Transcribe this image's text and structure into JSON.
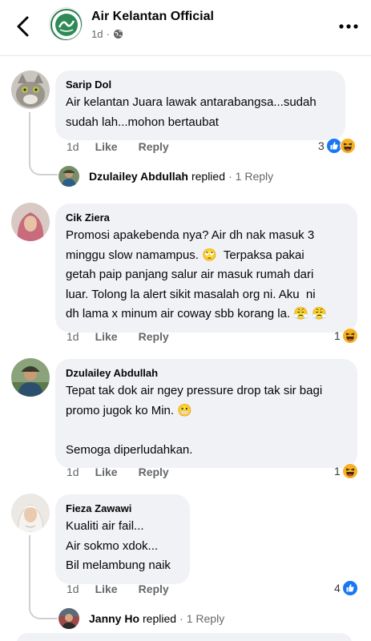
{
  "header": {
    "title": "Air Kelantan Official",
    "time": "1d",
    "privacy_icon": "globe-icon",
    "back_icon": "chevron-left-icon",
    "more_icon": "more-horizontal-icon"
  },
  "comments": [
    {
      "author": "Sarip Dol",
      "text": "Air kelantan Juara lawak antarabangsa...sudah\nsudah lah...mohon bertaubat",
      "time": "1d",
      "like": "Like",
      "reply": "Reply",
      "reactions": {
        "count": "3",
        "icons": [
          "like-reaction-icon",
          "haha-reaction-icon"
        ]
      },
      "replies": {
        "name": "Dzulailey Abdullah",
        "word": "replied",
        "dot": "·",
        "count": "1 Reply"
      }
    },
    {
      "author": "Cik Ziera",
      "text": "Promosi apakebenda nya? Air dh nak masuk 3\nminggu slow namampus. 🙄  Terpaksa pakai\ngetah paip panjang salur air masuk rumah dari\nluar. Tolong la alert sikit masalah org ni. Aku  ni\ndh lama x minum air coway sbb korang la. 😤 😤",
      "time": "1d",
      "like": "Like",
      "reply": "Reply",
      "reactions": {
        "count": "1",
        "icons": [
          "haha-reaction-icon"
        ]
      }
    },
    {
      "author": "Dzulailey Abdullah",
      "text": "Tepat tak dok air ngey pressure drop tak sir bagi\npromo jugok ko Min. 😬\n\nSemoga diperludahkan.",
      "time": "1d",
      "like": "Like",
      "reply": "Reply",
      "reactions": {
        "count": "1",
        "icons": [
          "haha-reaction-icon"
        ]
      }
    },
    {
      "author": "Fieza Zawawi",
      "text": "Kualiti air fail...\nAir sokmo xdok...\nBil melambung naik",
      "time": "1d",
      "like": "Like",
      "reply": "Reply",
      "reactions": {
        "count": "4",
        "icons": [
          "like-reaction-icon"
        ]
      },
      "replies": {
        "name": "Janny Ho",
        "word": "replied",
        "dot": "·",
        "count": "1 Reply"
      }
    }
  ],
  "colors": {
    "like_blue": "#1877f2",
    "haha_yellow": "#f7b125",
    "meta_gray": "#65676b",
    "bubble_bg": "#f0f2f5"
  }
}
